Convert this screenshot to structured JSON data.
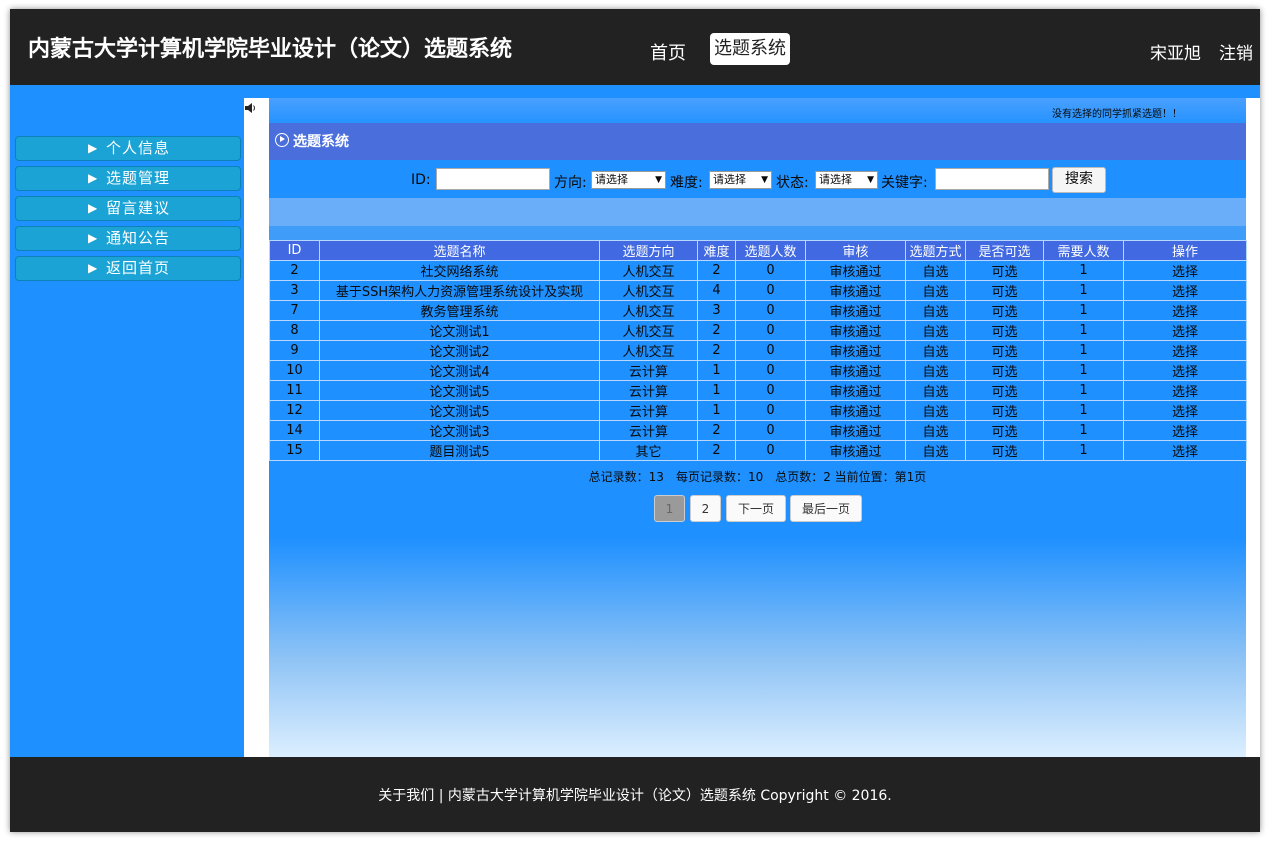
{
  "header": {
    "site_title": "内蒙古大学计算机学院毕业设计（论文）选题系统",
    "nav_home": "首页",
    "nav_select": "选题系统",
    "user_name": "宋亚旭",
    "logout": "注销"
  },
  "sidebar": {
    "items": [
      {
        "label": "个人信息"
      },
      {
        "label": "选题管理"
      },
      {
        "label": "留言建议"
      },
      {
        "label": "通知公告"
      },
      {
        "label": "返回首页"
      }
    ]
  },
  "notice": "没有选择的同学抓紧选题！！",
  "panel_title": "选题系统",
  "search": {
    "id_label": "ID:",
    "id_value": "",
    "direction_label": "方向:",
    "direction_value": "请选择",
    "difficulty_label": "难度:",
    "difficulty_value": "请选择",
    "status_label": "状态:",
    "status_value": "请选择",
    "keyword_label": "关键字:",
    "keyword_value": "",
    "button": "搜索"
  },
  "table": {
    "headers": [
      "ID",
      "选题名称",
      "选题方向",
      "难度",
      "选题人数",
      "审核",
      "选题方式",
      "是否可选",
      "需要人数",
      "操作"
    ],
    "rows": [
      [
        "2",
        "社交网络系统",
        "人机交互",
        "2",
        "0",
        "审核通过",
        "自选",
        "可选",
        "1",
        "选择"
      ],
      [
        "3",
        "基于SSH架构人力资源管理系统设计及实现",
        "人机交互",
        "4",
        "0",
        "审核通过",
        "自选",
        "可选",
        "1",
        "选择"
      ],
      [
        "7",
        "教务管理系统",
        "人机交互",
        "3",
        "0",
        "审核通过",
        "自选",
        "可选",
        "1",
        "选择"
      ],
      [
        "8",
        "论文测试1",
        "人机交互",
        "2",
        "0",
        "审核通过",
        "自选",
        "可选",
        "1",
        "选择"
      ],
      [
        "9",
        "论文测试2",
        "人机交互",
        "2",
        "0",
        "审核通过",
        "自选",
        "可选",
        "1",
        "选择"
      ],
      [
        "10",
        "论文测试4",
        "云计算",
        "1",
        "0",
        "审核通过",
        "自选",
        "可选",
        "1",
        "选择"
      ],
      [
        "11",
        "论文测试5",
        "云计算",
        "1",
        "0",
        "审核通过",
        "自选",
        "可选",
        "1",
        "选择"
      ],
      [
        "12",
        "论文测试5",
        "云计算",
        "1",
        "0",
        "审核通过",
        "自选",
        "可选",
        "1",
        "选择"
      ],
      [
        "14",
        "论文测试3",
        "云计算",
        "2",
        "0",
        "审核通过",
        "自选",
        "可选",
        "1",
        "选择"
      ],
      [
        "15",
        "题目测试5",
        "其它",
        "2",
        "0",
        "审核通过",
        "自选",
        "可选",
        "1",
        "选择"
      ]
    ]
  },
  "summary": "总记录数：13　每页记录数：10　总页数：2  当前位置：第1页",
  "pagination": {
    "page1": "1",
    "page2": "2",
    "next": "下一页",
    "last": "最后一页"
  },
  "footer": "关于我们 | 内蒙古大学计算机学院毕业设计（论文）选题系统 Copyright © 2016."
}
